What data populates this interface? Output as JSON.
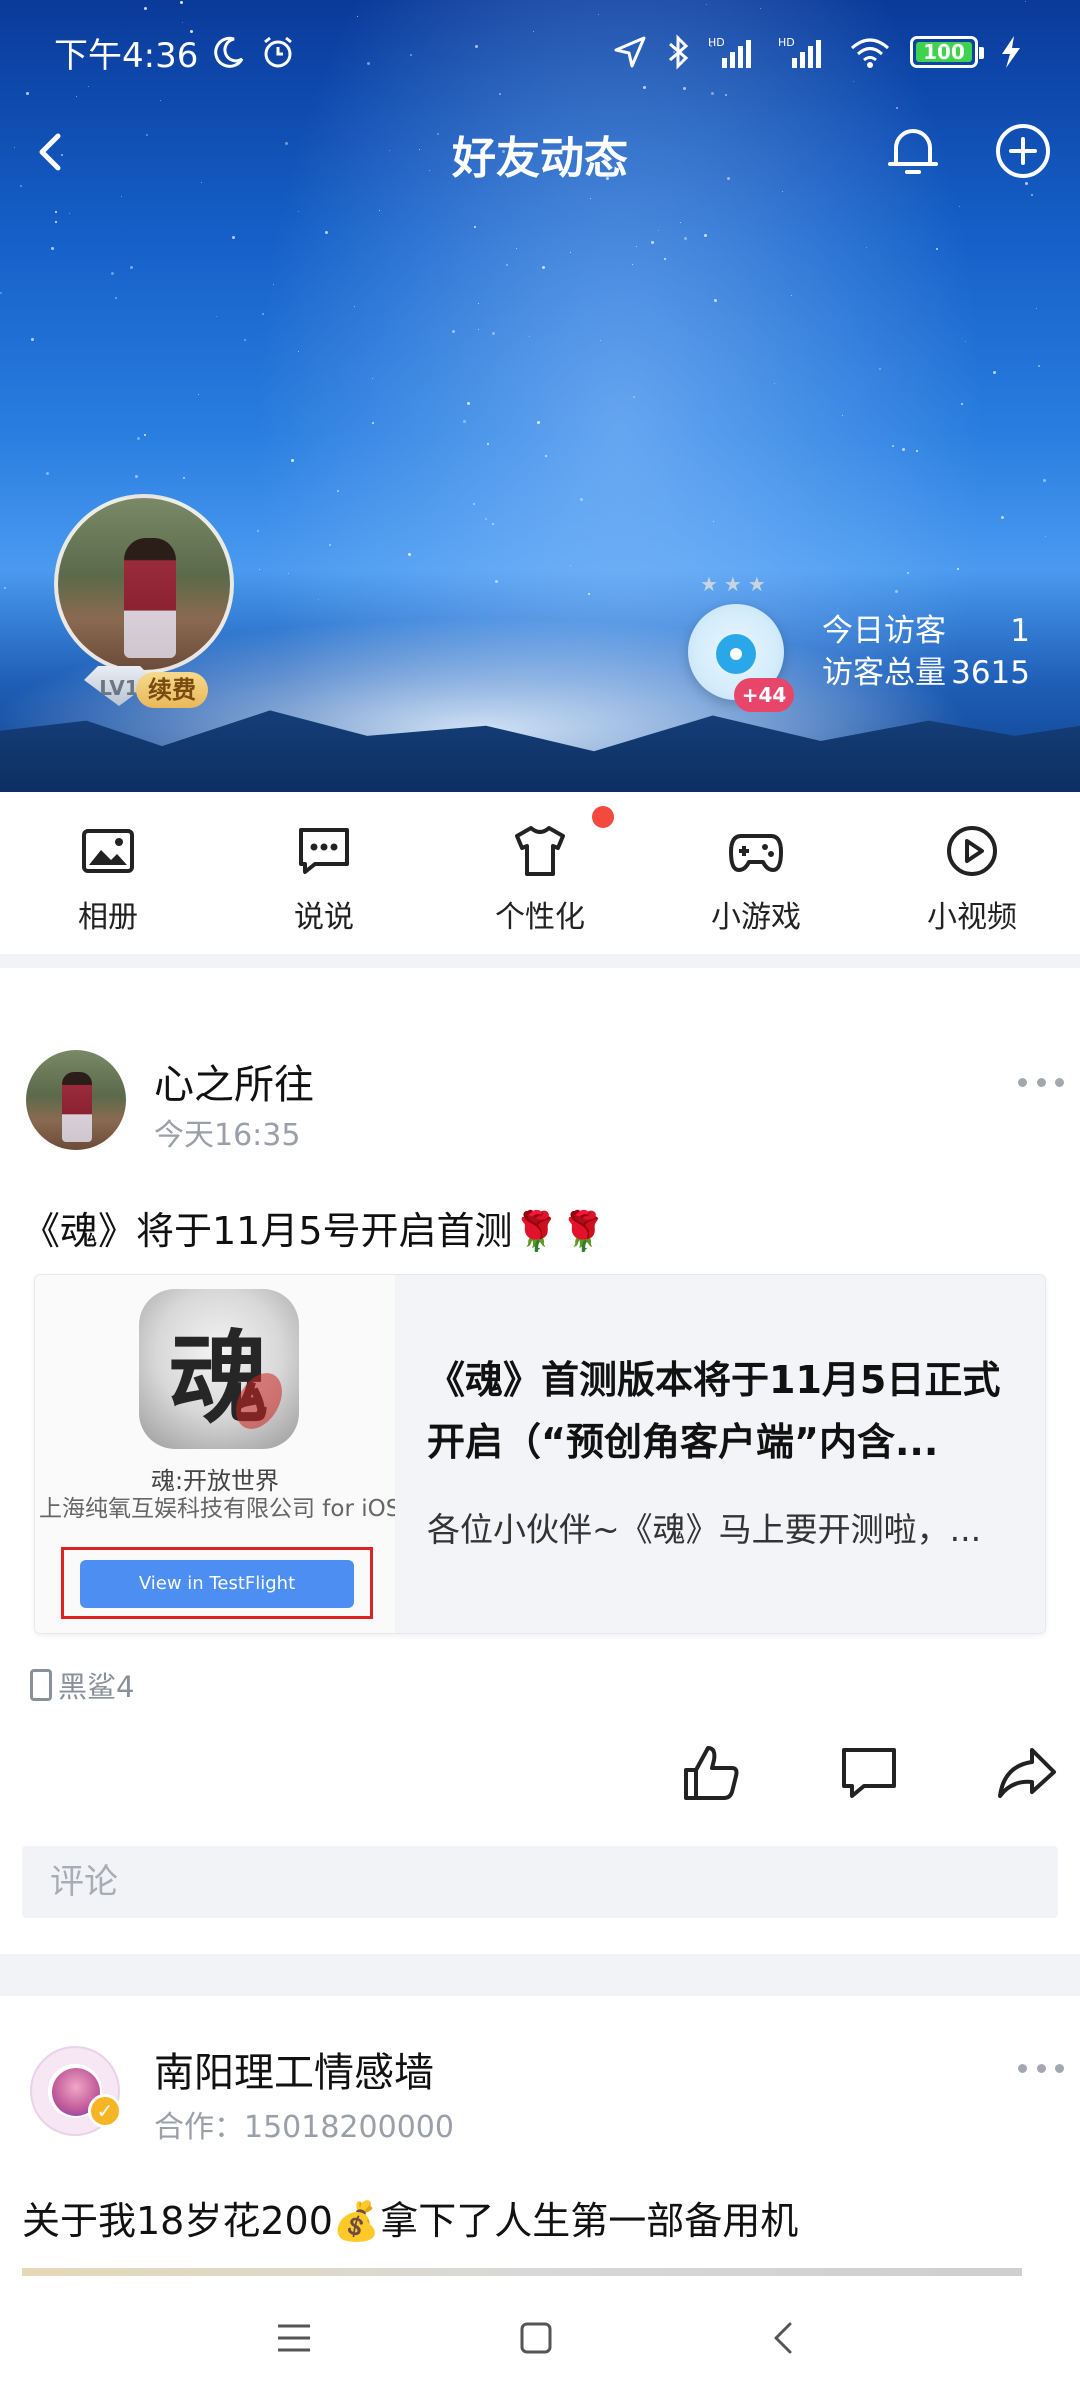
{
  "status_bar": {
    "time": "下午4:36",
    "battery": "100"
  },
  "header": {
    "title": "好友动态"
  },
  "profile": {
    "level": "LV1",
    "renew_badge": "续费",
    "visitor_plus": "+44",
    "today_visitors_label": "今日访客",
    "today_visitors_value": "1",
    "total_visitors_label": "访客总量",
    "total_visitors_value": "3615"
  },
  "shortcuts": [
    {
      "label": "相册",
      "icon": "album-icon"
    },
    {
      "label": "说说",
      "icon": "chat-bubble-icon"
    },
    {
      "label": "个性化",
      "icon": "tshirt-icon"
    },
    {
      "label": "小游戏",
      "icon": "gamepad-icon"
    },
    {
      "label": "小视频",
      "icon": "play-circle-icon"
    }
  ],
  "post1": {
    "author": "心之所往",
    "time": "今天16:35",
    "text": "《魂》将于11月5号开启首测🌹🌹",
    "card": {
      "thumb_title": "魂:开放世界",
      "thumb_company": "上海纯氧互娱科技有限公司 for iOS",
      "thumb_button": "View in TestFlight",
      "title": "《魂》首测版本将于11月5日正式开启（“预创角客户端”内含...",
      "desc": "各位小伙伴~《魂》马上要开测啦，..."
    },
    "device": "黑鲨4",
    "comment_placeholder": "评论"
  },
  "post2": {
    "author": "南阳理工情感墙",
    "subtitle": "合作：15018200000",
    "text": "关于我18岁花200💰拿下了人生第一部备用机"
  },
  "colors": {
    "accent_red": "#f44a3e",
    "testflight_blue": "#4d8ef2",
    "verify_gold": "#f5b524"
  }
}
